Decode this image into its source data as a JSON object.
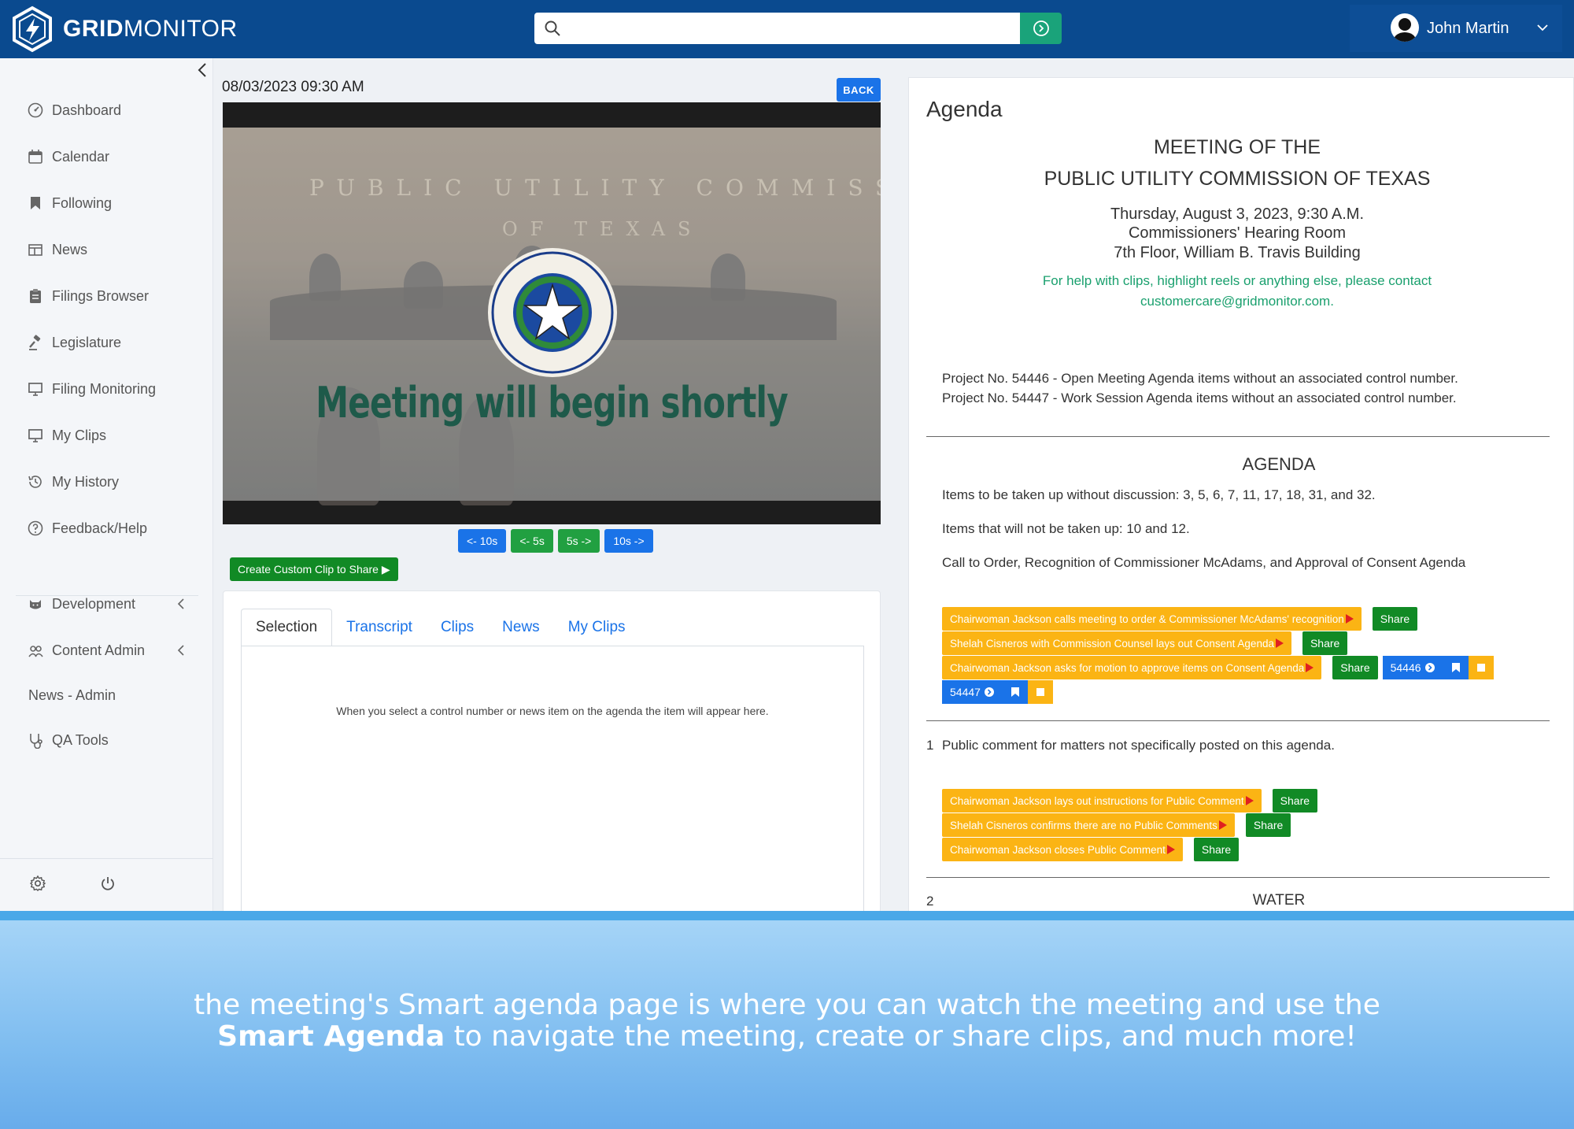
{
  "brand": {
    "bold": "GRID",
    "light": "MONITOR"
  },
  "search": {
    "value": "",
    "placeholder": ""
  },
  "user": {
    "name": "John Martin"
  },
  "sidebar": {
    "items": [
      {
        "label": "Dashboard",
        "icon": "dashboard-icon"
      },
      {
        "label": "Calendar",
        "icon": "calendar-icon"
      },
      {
        "label": "Following",
        "icon": "bookmark-icon"
      },
      {
        "label": "News",
        "icon": "newspaper-icon"
      },
      {
        "label": "Filings Browser",
        "icon": "clipboard-icon"
      },
      {
        "label": "Legislature",
        "icon": "gavel-icon"
      },
      {
        "label": "Filing Monitoring",
        "icon": "monitor-icon"
      },
      {
        "label": "My Clips",
        "icon": "monitor-icon"
      },
      {
        "label": "My History",
        "icon": "history-icon"
      },
      {
        "label": "Feedback/Help",
        "icon": "help-icon"
      }
    ],
    "admin_items": [
      {
        "label": "Development",
        "icon": "cat-icon",
        "expandable": true
      },
      {
        "label": "Content Admin",
        "icon": "users-icon",
        "expandable": true
      },
      {
        "label": "News - Admin",
        "icon": "",
        "expandable": false
      },
      {
        "label": "QA Tools",
        "icon": "stethoscope-icon",
        "expandable": false
      }
    ]
  },
  "player": {
    "timestamp": "08/03/2023 09:30 AM",
    "back_label": "BACK",
    "wall_line1": "PUBLIC UTILITY COMMISSION",
    "wall_line2": "OF TEXAS",
    "message": "Meeting will begin shortly",
    "skip": [
      "<- 10s",
      "<- 5s",
      "5s ->",
      "10s ->"
    ],
    "clip_label": "Create Custom Clip to Share ▶"
  },
  "tabs": {
    "items": [
      "Selection",
      "Transcript",
      "Clips",
      "News",
      "My Clips"
    ],
    "active": "Selection",
    "empty_message": "When you select a control number or news item on the agenda the item will appear here."
  },
  "agenda": {
    "heading": "Agenda",
    "title1": "MEETING OF THE",
    "title2": "PUBLIC UTILITY COMMISSION OF TEXAS",
    "date_line": "Thursday, August 3, 2023, 9:30 A.M.",
    "room_line": "Commissioners' Hearing Room",
    "building_line": "7th Floor, William B. Travis Building",
    "help_line1": "For help with clips, highlight reels or anything else, please contact",
    "help_line2": "customercare@gridmonitor.com.",
    "project1": "Project No. 54446 - Open Meeting Agenda items without an associated control number.",
    "project2": "Project No. 54447 - Work Session Agenda items without an associated control number.",
    "section_heading": "AGENDA",
    "no_discussion": "Items to be taken up without discussion: 3, 5, 6, 7, 11, 17, 18, 31, and 32.",
    "not_taken": "Items that will not be taken up: 10 and 12.",
    "call_to_order": "Call to Order, Recognition of Commissioner McAdams, and Approval of Consent Agenda",
    "clips_a": [
      "Chairwoman Jackson calls meeting to order & Commissioner McAdams' recognition",
      "Shelah Cisneros with Commission Counsel lays out Consent Agenda",
      "Chairwoman Jackson asks for motion to approve items on Consent Agenda"
    ],
    "share_label": "Share",
    "control_numbers": [
      "54446",
      "54447"
    ],
    "item1_num": "1",
    "item1_text": "Public comment for matters not specifically posted on this agenda.",
    "clips_b": [
      "Chairwoman Jackson lays out instructions for Public Comment",
      "Shelah Cisneros confirms there are no Public Comments",
      "Chairwoman Jackson closes Public Comment"
    ],
    "item2_num": "2",
    "item2_text": "WATER"
  },
  "caption": {
    "line1": "the meeting's Smart agenda page is where you can watch the meeting and use the",
    "line2_bold": "Smart Agenda",
    "line2_rest": " to navigate the meeting, create or share clips, and much more!"
  },
  "colors": {
    "topbar": "#0a4a8f",
    "accent_blue": "#1a73e8",
    "share_green": "#118a25",
    "clip_yellow": "#fbb414",
    "help_green": "#1aa06e"
  }
}
